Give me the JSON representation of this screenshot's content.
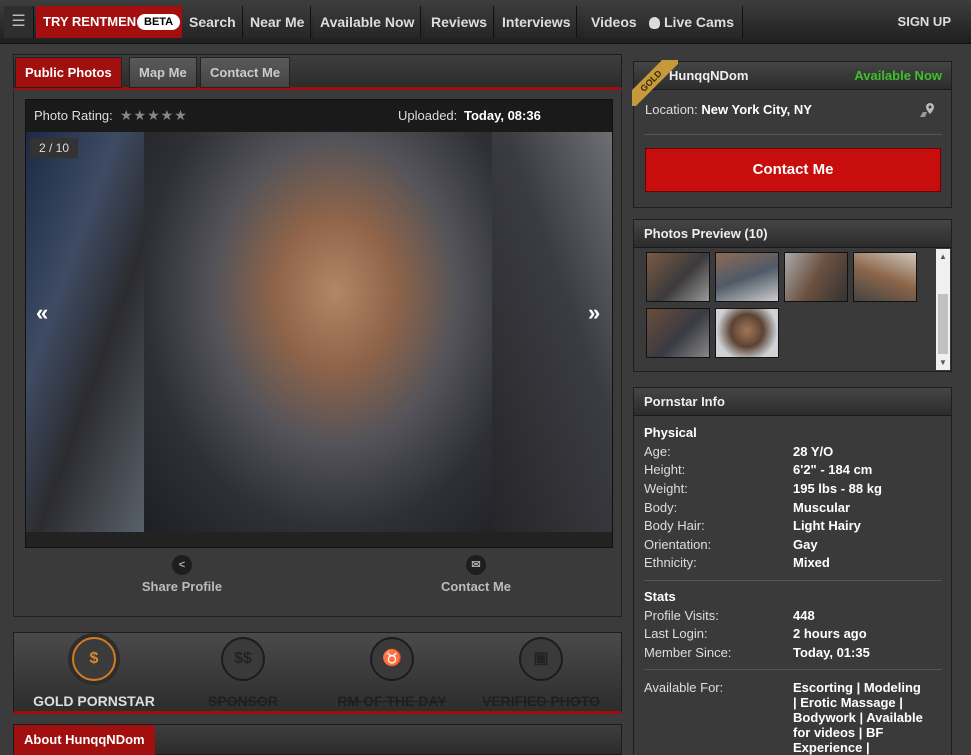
{
  "nav": {
    "menu_icon": "☰",
    "try_label": "TRY RENTMEN",
    "beta": "BETA",
    "items": [
      "Search",
      "Near Me",
      "Available Now",
      "Reviews",
      "Interviews",
      "Videos",
      "Live Cams"
    ],
    "live_cams_icon": "cam-icon",
    "signup": "SIGN UP"
  },
  "tabs": [
    "Public Photos",
    "Map Me",
    "Contact Me"
  ],
  "viewer": {
    "rating_label": "Photo Rating:",
    "stars": "★★★★★",
    "uploaded_label": "Uploaded:",
    "uploaded_value": "Today, 08:36",
    "counter": "2 / 10",
    "prev": "«",
    "next": "»"
  },
  "actions": {
    "share": "Share Profile",
    "contact": "Contact Me"
  },
  "badges": [
    {
      "label": "GOLD PORNSTAR",
      "icon": "$",
      "active": true
    },
    {
      "label": "SPONSOR",
      "icon": "$$",
      "active": false
    },
    {
      "label": "RM OF THE DAY",
      "icon": "♉",
      "active": false
    },
    {
      "label": "VERIFIED PHOTO",
      "icon": "▣",
      "active": false
    }
  ],
  "about_label": "About HunqqNDom",
  "profile": {
    "gold_ribbon": "GOLD",
    "username": "HunqqNDom",
    "status": "Available Now",
    "status_color": "#3fbf2a",
    "location_label": "Location:",
    "location_value": "New York City, NY",
    "contact_button": "Contact Me"
  },
  "photos_preview": {
    "title": "Photos Preview (10)"
  },
  "info": {
    "title": "Pornstar Info",
    "physical_title": "Physical",
    "physical": [
      {
        "label": "Age:",
        "value": "28 Y/O"
      },
      {
        "label": "Height:",
        "value": "6'2\" - 184 cm"
      },
      {
        "label": "Weight:",
        "value": "195 lbs - 88 kg"
      },
      {
        "label": "Body:",
        "value": "Muscular"
      },
      {
        "label": "Body Hair:",
        "value": "Light Hairy"
      },
      {
        "label": "Orientation:",
        "value": "Gay"
      },
      {
        "label": "Ethnicity:",
        "value": "Mixed"
      }
    ],
    "stats_title": "Stats",
    "stats": [
      {
        "label": "Profile Visits:",
        "value": "448"
      },
      {
        "label": "Last Login:",
        "value": "2 hours ago"
      },
      {
        "label": "Member Since:",
        "value": "Today, 01:35"
      }
    ],
    "available_label": "Available For:",
    "available_lines": [
      "Escorting | Modeling",
      "| Erotic Massage |",
      "Bodywork | Available",
      "for videos | BF",
      "Experience |"
    ]
  }
}
